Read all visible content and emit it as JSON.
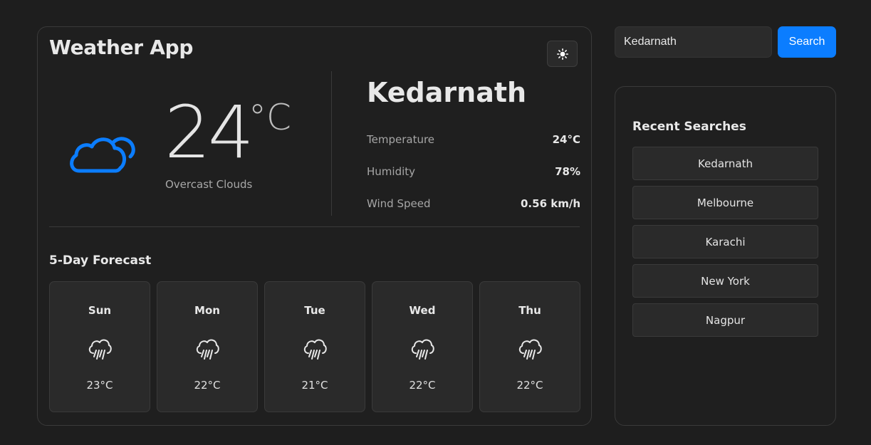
{
  "app": {
    "title": "Weather App",
    "theme_toggle_icon": "sun-icon"
  },
  "current": {
    "temperature": "24",
    "unit": "°C",
    "condition": "Overcast Clouds",
    "icon": "cloud-icon",
    "icon_color": "#0b7dff",
    "city": "Kedarnath",
    "details": [
      {
        "label": "Temperature",
        "value": "24°C"
      },
      {
        "label": "Humidity",
        "value": "78%"
      },
      {
        "label": "Wind Speed",
        "value": "0.56 km/h"
      }
    ]
  },
  "forecast": {
    "title": "5-Day Forecast",
    "days": [
      {
        "day": "Sun",
        "temp": "23°C",
        "icon": "rain-cloud-icon"
      },
      {
        "day": "Mon",
        "temp": "22°C",
        "icon": "rain-cloud-icon"
      },
      {
        "day": "Tue",
        "temp": "21°C",
        "icon": "rain-cloud-icon"
      },
      {
        "day": "Wed",
        "temp": "22°C",
        "icon": "rain-cloud-icon"
      },
      {
        "day": "Thu",
        "temp": "22°C",
        "icon": "rain-cloud-icon"
      }
    ]
  },
  "search": {
    "value": "Kedarnath",
    "button_label": "Search",
    "button_color": "#0b7dff"
  },
  "recent": {
    "title": "Recent Searches",
    "items": [
      "Kedarnath",
      "Melbourne",
      "Karachi",
      "New York",
      "Nagpur"
    ]
  }
}
